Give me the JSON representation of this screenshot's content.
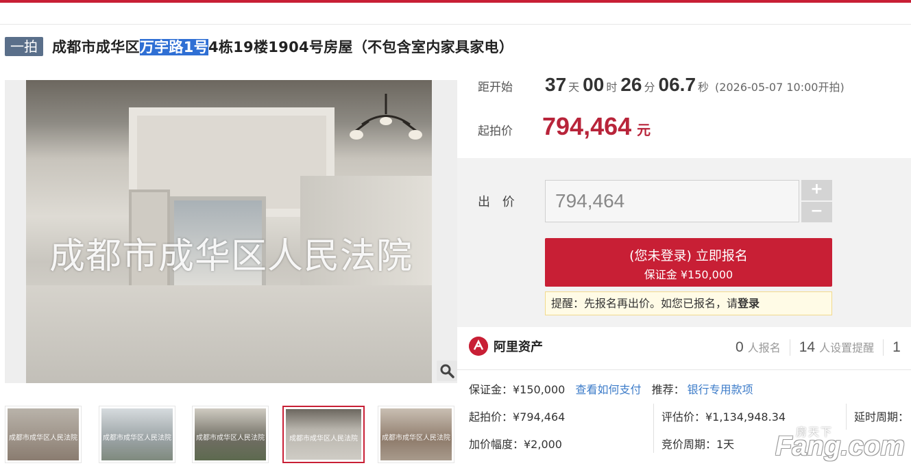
{
  "title": {
    "badge": "一拍",
    "before": "成都市成华区",
    "highlight": "万宇路1号",
    "after": "4栋19楼1904号房屋（不包含室内家具家电）"
  },
  "main_image": {
    "watermark": "成都市成华区人民法院",
    "zoom_icon": "magnifier-icon"
  },
  "thumbnails": [
    {
      "watermark": "成都市成华区人民法院",
      "tone": "#8a7c70"
    },
    {
      "watermark": "成都市成华区人民法院",
      "tone": "#9aa2a4"
    },
    {
      "watermark": "成都市成华区人民法院",
      "tone": "#6f6d62"
    },
    {
      "watermark": "成都市成华区人民法院",
      "tone": "#b8b4ac"
    },
    {
      "watermark": "成都市成华区人民法院",
      "tone": "#8f7c6c"
    }
  ],
  "countdown": {
    "label": "距开始",
    "days": "37",
    "days_unit": "天",
    "hours": "00",
    "hours_unit": "时",
    "minutes": "26",
    "minutes_unit": "分",
    "seconds": "06.7",
    "seconds_unit": "秒",
    "start_note": "(2026-05-07 10:00开拍)"
  },
  "starting_price": {
    "label": "起拍价",
    "value": "794,464",
    "unit": "元"
  },
  "bid": {
    "label": "出 价",
    "input_value": "794,464",
    "plus": "+",
    "minus": "−"
  },
  "signup": {
    "line1": "(您未登录) 立即报名",
    "line2": "保证金 ¥150,000"
  },
  "reminder": {
    "text": "提醒：先报名再出价。如您已报名，请",
    "link": "登录"
  },
  "brand": {
    "name": "阿里资产"
  },
  "stats": {
    "signups_count": "0",
    "signups_label": "人报名",
    "reminders_count": "14",
    "reminders_label": "人设置提醒",
    "third_count": "1"
  },
  "details": {
    "deposit": "保证金：¥150,000",
    "how_to_pay": "查看如何支付",
    "recommend_label": "推荐：",
    "recommend_link": "银行专用款项",
    "start_price": "起拍价：¥794,464",
    "appraisal": "评估价：¥1,134,948.34",
    "delay_cycle": "延时周期：",
    "increment": "加价幅度：¥2,000",
    "bid_cycle": "竞价周期：1天"
  },
  "watermark_logo": {
    "line1": "房天下",
    "line2": "Fang.com"
  },
  "colors": {
    "accent": "#c81f35",
    "badge": "#5a6f8a",
    "link": "#3d7cc9",
    "price": "#b8243a"
  }
}
